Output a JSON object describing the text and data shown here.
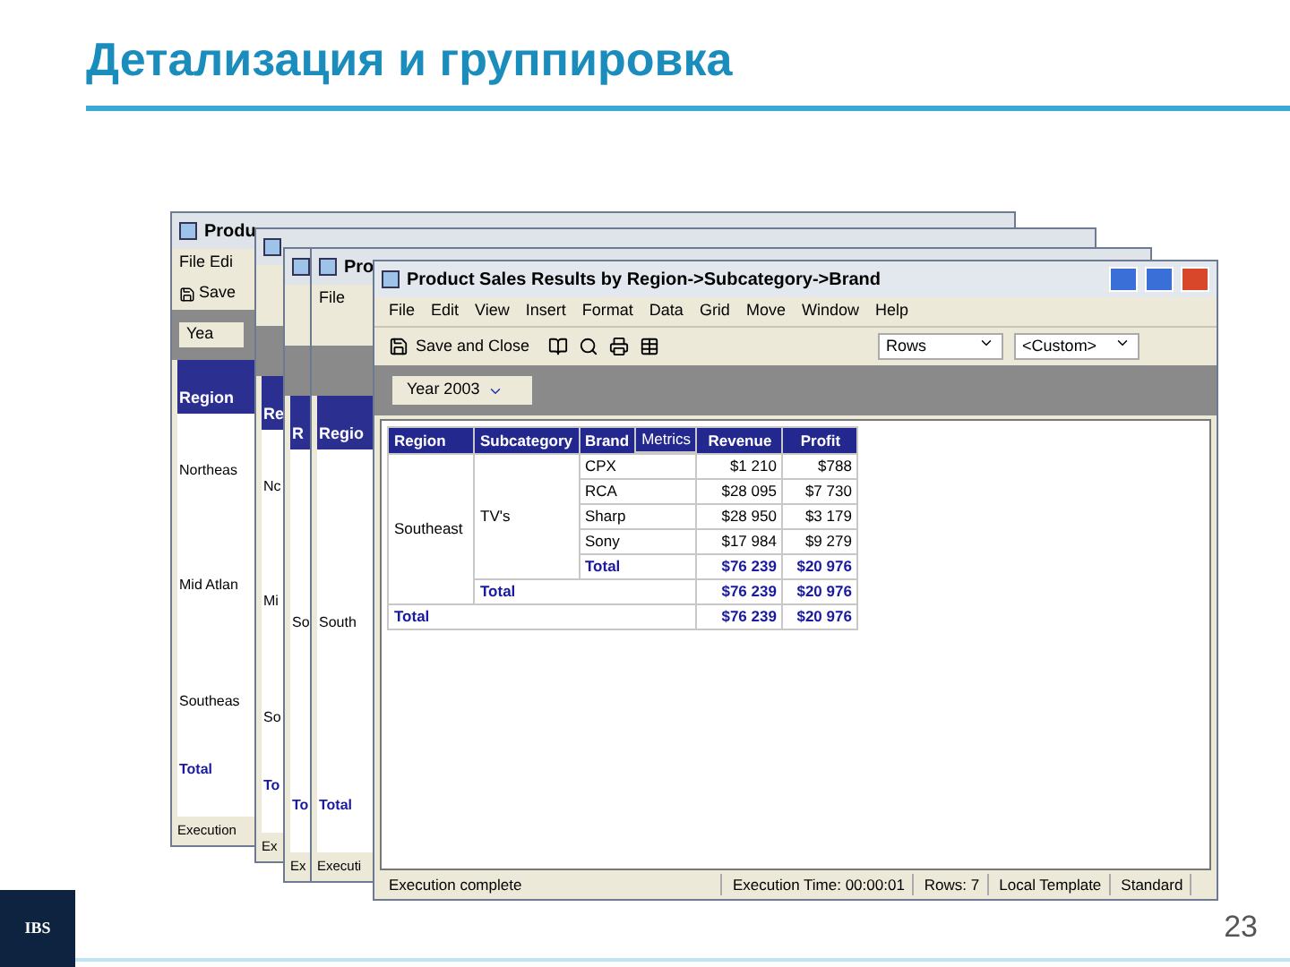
{
  "slide": {
    "title": "Детализация и группировка",
    "logo": "IBS",
    "page_number": "23"
  },
  "back_windows": [
    {
      "title": "Produ",
      "menu": "File Edi",
      "save": "Save",
      "year": "Yea",
      "header": "Region",
      "rows": [
        "Northeas",
        "Mid Atlan",
        "Southeas"
      ],
      "total": "Total",
      "status": "Execution"
    },
    {
      "header": "Re",
      "rows": [
        "Nc",
        "Mi",
        "So"
      ],
      "total": "To",
      "status": "Ex"
    },
    {
      "header": "R",
      "rows": [
        "So"
      ],
      "total": "To",
      "status": "Ex"
    },
    {
      "title": "Pro",
      "menu": "File",
      "header": "Regio",
      "rows": [
        "South"
      ],
      "total": "Total",
      "status": "Executi"
    }
  ],
  "window": {
    "title": "Product Sales Results by Region->Subcategory->Brand",
    "menu": [
      "File",
      "Edit",
      "View",
      "Insert",
      "Format",
      "Data",
      "Grid",
      "Move",
      "Window",
      "Help"
    ],
    "toolbar": {
      "save": "Save and Close",
      "axis": "Rows",
      "template": "<Custom>"
    },
    "page_by": "Year 2003",
    "table": {
      "metrics_label": "Metrics",
      "columns": [
        "Region",
        "Subcategory",
        "Brand",
        "Revenue",
        "Profit"
      ],
      "region": "Southeast",
      "subcategory": "TV's",
      "brands": [
        {
          "name": "CPX",
          "revenue": "$1 210",
          "profit": "$788"
        },
        {
          "name": "RCA",
          "revenue": "$28 095",
          "profit": "$7 730"
        },
        {
          "name": "Sharp",
          "revenue": "$28 950",
          "profit": "$3 179"
        },
        {
          "name": "Sony",
          "revenue": "$17 984",
          "profit": "$9 279"
        }
      ],
      "brand_total": {
        "label": "Total",
        "revenue": "$76 239",
        "profit": "$20 976"
      },
      "subcategory_total": {
        "label": "Total",
        "revenue": "$76 239",
        "profit": "$20 976"
      },
      "grand_total": {
        "label": "Total",
        "revenue": "$76 239",
        "profit": "$20 976"
      }
    },
    "status_bar": [
      "Execution complete",
      "Execution Time: 00:00:01",
      "Rows: 7",
      "Local Template",
      "Standard"
    ]
  }
}
